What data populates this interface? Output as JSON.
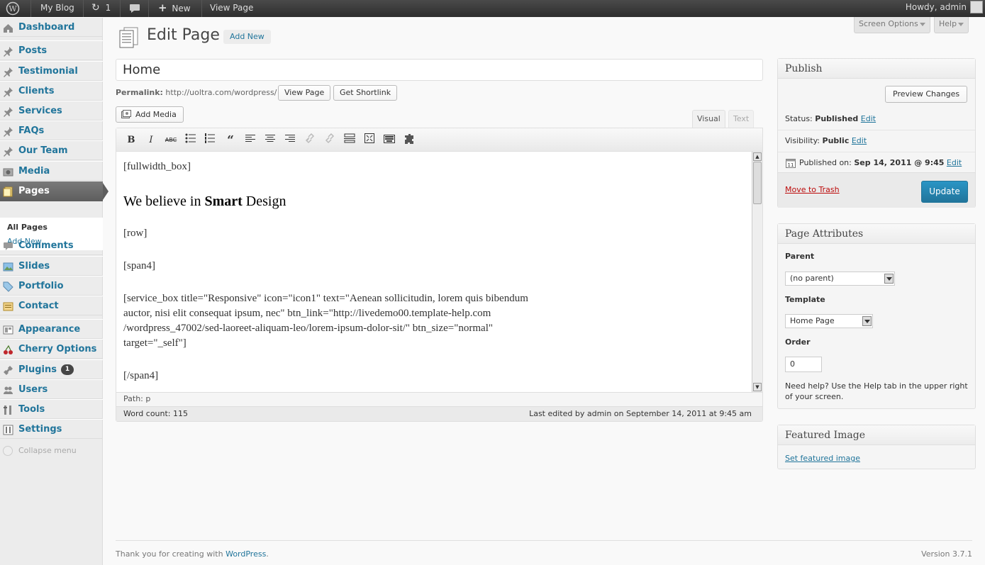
{
  "adminbar": {
    "site_name": "My Blog",
    "updates_count": "1",
    "new_label": "New",
    "view_page_label": "View Page",
    "howdy": "Howdy, admin"
  },
  "sidebar": {
    "items": [
      {
        "label": "Dashboard",
        "icon": "dashboard-icon"
      },
      {
        "label": "Posts",
        "icon": "pin-icon"
      },
      {
        "label": "Testimonial",
        "icon": "pin-icon"
      },
      {
        "label": "Clients",
        "icon": "pin-icon"
      },
      {
        "label": "Services",
        "icon": "pin-icon"
      },
      {
        "label": "FAQs",
        "icon": "pin-icon"
      },
      {
        "label": "Our Team",
        "icon": "pin-icon"
      },
      {
        "label": "Media",
        "icon": "media-icon"
      },
      {
        "label": "Pages",
        "icon": "pages-icon"
      },
      {
        "label": "Comments",
        "icon": "comments-icon"
      },
      {
        "label": "Slides",
        "icon": "slides-icon"
      },
      {
        "label": "Portfolio",
        "icon": "portfolio-icon"
      },
      {
        "label": "Contact",
        "icon": "contact-icon"
      },
      {
        "label": "Appearance",
        "icon": "appearance-icon"
      },
      {
        "label": "Cherry Options",
        "icon": "cherry-icon"
      },
      {
        "label": "Plugins",
        "icon": "plugins-icon"
      },
      {
        "label": "Users",
        "icon": "users-icon"
      },
      {
        "label": "Tools",
        "icon": "tools-icon"
      },
      {
        "label": "Settings",
        "icon": "settings-icon"
      }
    ],
    "submenu": {
      "all_pages": "All Pages",
      "add_new": "Add New"
    },
    "plugins_badge": "1",
    "collapse": "Collapse menu"
  },
  "header": {
    "screen_options": "Screen Options",
    "help": "Help",
    "title": "Edit Page",
    "add_new": "Add New"
  },
  "post": {
    "title": "Home",
    "permalink_label": "Permalink:",
    "permalink_url": "http://uoltra.com/wordpress/",
    "view_page_btn": "View Page",
    "get_shortlink_btn": "Get Shortlink",
    "add_media": "Add Media",
    "tab_visual": "Visual",
    "tab_text": "Text"
  },
  "editor": {
    "p1": "[fullwidth_box]",
    "h_pre": "We believe in ",
    "h_bold": "Smart",
    "h_post": " Design",
    "p2": "[row]",
    "p3": "[span4]",
    "p4_l1": "[service_box title=\"Responsive\" icon=\"icon1\" text=\"Aenean sollicitudin, lorem quis bibendum",
    "p4_l2": "auctor, nisi elit consequat ipsum, nec\" btn_link=\"http://livedemo00.template-help.com",
    "p4_l3": "/wordpress_47002/sed-laoreet-aliquam-leo/lorem-ipsum-dolor-sit/\" btn_size=\"normal\"",
    "p4_l4": "target=\"_self\"]",
    "p5": "[/span4]",
    "path": "Path: p",
    "word_count": "Word count: 115",
    "last_edited": "Last edited by admin on September 14, 2011 at 9:45 am"
  },
  "publish": {
    "title": "Publish",
    "preview": "Preview Changes",
    "status_label": "Status: ",
    "status_value": "Published",
    "visibility_label": "Visibility: ",
    "visibility_value": "Public",
    "published_label": "Published on: ",
    "published_value": "Sep 14, 2011 @ 9:45",
    "edit": "Edit",
    "trash": "Move to Trash",
    "update": "Update"
  },
  "attributes": {
    "title": "Page Attributes",
    "parent_label": "Parent",
    "parent_value": "(no parent)",
    "template_label": "Template",
    "template_value": "Home Page",
    "order_label": "Order",
    "order_value": "0",
    "help_text": "Need help? Use the Help tab in the upper right of your screen."
  },
  "featured": {
    "title": "Featured Image",
    "link": "Set featured image"
  },
  "footer": {
    "thanks_pre": "Thank you for creating with ",
    "thanks_link": "WordPress",
    "thanks_post": ".",
    "version": "Version 3.7.1"
  }
}
